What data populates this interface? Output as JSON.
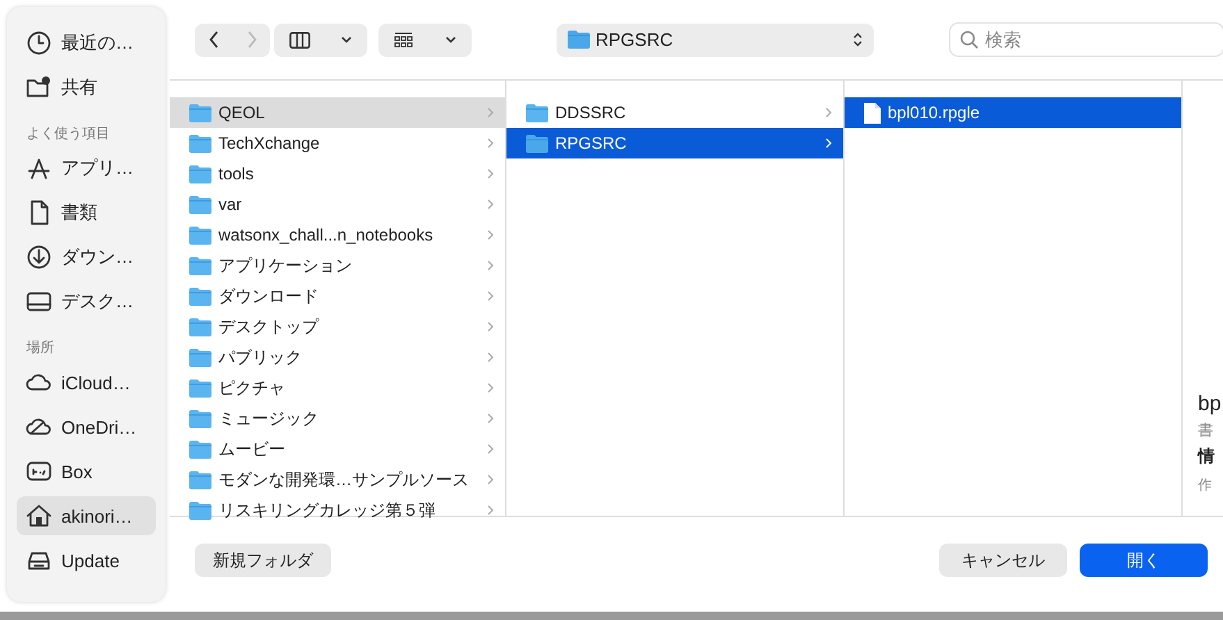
{
  "sidebar": {
    "sections": [
      {
        "items": [
          {
            "label": "最近の…",
            "kind": "recent",
            "selected": false
          },
          {
            "label": "共有",
            "kind": "shared",
            "selected": false
          }
        ]
      },
      {
        "title": "よく使う項目",
        "items": [
          {
            "label": "アプリ…",
            "kind": "apps",
            "selected": false
          },
          {
            "label": "書類",
            "kind": "document",
            "selected": false
          },
          {
            "label": "ダウン…",
            "kind": "download",
            "selected": false
          },
          {
            "label": "デスク…",
            "kind": "desktop",
            "selected": false
          }
        ]
      },
      {
        "title": "場所",
        "items": [
          {
            "label": "iCloud…",
            "kind": "cloud",
            "selected": false
          },
          {
            "label": "OneDri…",
            "kind": "onedrive",
            "selected": false
          },
          {
            "label": "Box",
            "kind": "box",
            "selected": false
          },
          {
            "label": "akinori…",
            "kind": "home",
            "selected": true
          },
          {
            "label": "Update",
            "kind": "drive",
            "selected": false
          }
        ]
      }
    ]
  },
  "toolbar": {
    "path": "RPGSRC",
    "search": {
      "placeholder": "検索"
    }
  },
  "columns": [
    {
      "focused": false,
      "items": [
        {
          "name": "QEOL",
          "kind": "folder",
          "expandable": true,
          "selected": true
        },
        {
          "name": "TechXchange",
          "kind": "folder",
          "expandable": true,
          "selected": false
        },
        {
          "name": "tools",
          "kind": "folder",
          "expandable": true,
          "selected": false
        },
        {
          "name": "var",
          "kind": "folder",
          "expandable": true,
          "selected": false
        },
        {
          "name": "watsonx_chall...n_notebooks",
          "kind": "folder",
          "expandable": true,
          "selected": false
        },
        {
          "name": "アプリケーション",
          "kind": "folder",
          "expandable": true,
          "selected": false
        },
        {
          "name": "ダウンロード",
          "kind": "folder",
          "expandable": true,
          "selected": false
        },
        {
          "name": "デスクトップ",
          "kind": "folder",
          "expandable": true,
          "selected": false
        },
        {
          "name": "パブリック",
          "kind": "folder",
          "expandable": true,
          "selected": false
        },
        {
          "name": "ピクチャ",
          "kind": "folder",
          "expandable": true,
          "selected": false
        },
        {
          "name": "ミュージック",
          "kind": "folder",
          "expandable": true,
          "selected": false
        },
        {
          "name": "ムービー",
          "kind": "folder",
          "expandable": true,
          "selected": false
        },
        {
          "name": "モダンな開発環…サンプルソース",
          "kind": "folder",
          "expandable": true,
          "selected": false
        },
        {
          "name": "リスキリングカレッジ第５弾",
          "kind": "folder",
          "expandable": true,
          "selected": false
        }
      ]
    },
    {
      "focused": true,
      "items": [
        {
          "name": "DDSSRC",
          "kind": "folder",
          "expandable": true,
          "selected": false
        },
        {
          "name": "RPGSRC",
          "kind": "folder",
          "expandable": true,
          "selected": true
        }
      ]
    },
    {
      "focused": true,
      "items": [
        {
          "name": "bpl010.rpgle",
          "kind": "file",
          "expandable": false,
          "selected": true
        }
      ]
    }
  ],
  "preview": {
    "name": "bp",
    "kind": "書",
    "info_heading": "情",
    "created_label": "作"
  },
  "buttons": {
    "new_folder": "新規フォルダ",
    "cancel": "キャンセル",
    "open": "開く"
  }
}
